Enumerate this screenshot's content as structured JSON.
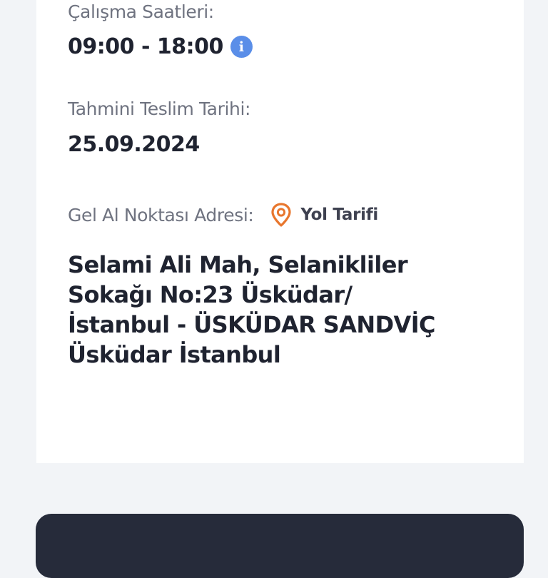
{
  "working_hours": {
    "label": "Çalışma Saatleri:",
    "value": "09:00 - 18:00"
  },
  "estimated_delivery": {
    "label": "Tahmini Teslim Tarihi:",
    "value": "25.09.2024"
  },
  "pickup": {
    "label": "Gel Al Noktası Adresi:",
    "directions_label": "Yol Tarifi",
    "address_lines": [
      "Selami Ali Mah, Selanikliler",
      "Sokağı No:23 Üsküdar/",
      "İstanbul - ÜSKÜDAR SANDVİÇ",
      "Üsküdar İstanbul"
    ]
  },
  "icons": {
    "info": "info-icon",
    "pin": "map-pin-icon"
  },
  "colors": {
    "info_blue": "#5a8ee8",
    "pin_orange": "#e8762d",
    "bottom_bar": "#262b3a"
  }
}
